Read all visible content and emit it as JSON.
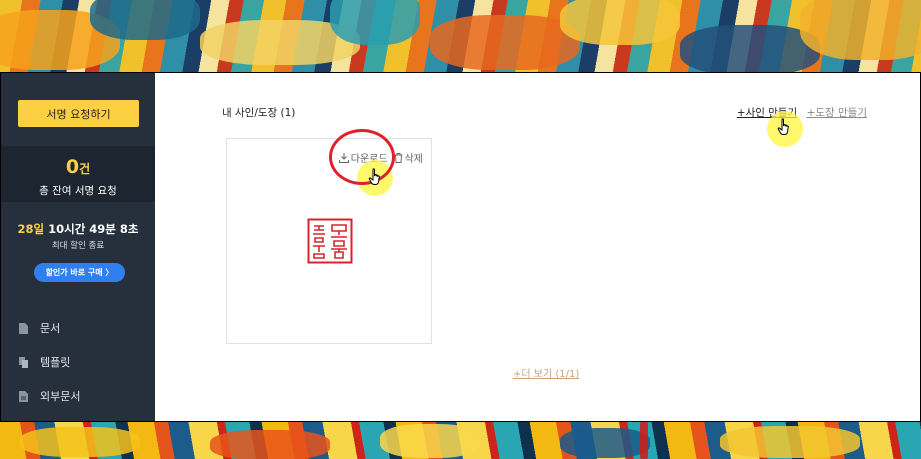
{
  "sidebar": {
    "request_button": "서명 요청하기",
    "count": {
      "number": "0",
      "unit": "건",
      "label": "총 잔여 서명 요청"
    },
    "timer": {
      "days": "28일",
      "rest": " 10시간 49분 8초",
      "sub": "최대 할인 종료"
    },
    "buy_button": "할인가 바로 구매 〉",
    "nav": [
      {
        "label": "문서",
        "icon": "document-icon"
      },
      {
        "label": "템플릿",
        "icon": "template-icon"
      },
      {
        "label": "외부문서",
        "icon": "external-document-icon"
      }
    ]
  },
  "main": {
    "title": "내 사인/도장 (1)",
    "make_sign": "+사인 만들기",
    "make_stamp": "+도장 만들기",
    "card": {
      "download": "다운로드",
      "delete": "삭제"
    },
    "more": "+더 보기 (1/1)"
  },
  "colors": {
    "accent_yellow": "#fdd043",
    "sidebar_bg": "#26303c",
    "buy_blue": "#2f7ff0",
    "seal_red": "#d7262b"
  }
}
